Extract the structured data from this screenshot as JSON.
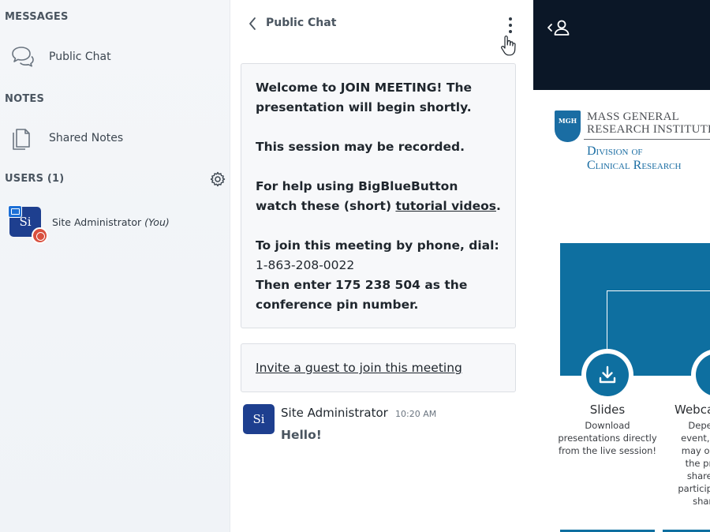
{
  "sidebar": {
    "messages_label": "MESSAGES",
    "public_chat_label": "Public Chat",
    "notes_label": "NOTES",
    "shared_notes_label": "Shared Notes",
    "users_label": "USERS (1)",
    "user": {
      "initials": "Si",
      "name": "Site Administrator",
      "you": "(You)"
    }
  },
  "chat": {
    "title": "Public Chat",
    "welcome": {
      "p1": "Welcome to JOIN MEETING! The presentation will begin shortly.",
      "p2": "This session may be recorded.",
      "p3_pre": "For help using BigBlueButton watch these (short) ",
      "p3_link": "tutorial videos",
      "p3_post": ".",
      "p4_line1": "To join this meeting by phone, dial:",
      "p4_line2": "1-863-208-0022",
      "p4_line3": "Then enter 175 238 504 as the conference pin number."
    },
    "invite_link": "Invite a guest to join this meeting",
    "message": {
      "avatar": "Si",
      "sender": "Site Administrator",
      "time": "10:20 AM",
      "text": "Hello!"
    }
  },
  "presentation": {
    "logo_seal": "MGH",
    "logo_line1": "MASS GENERAL",
    "logo_line2": "RESEARCH INSTITUTE",
    "division_line1": "Division of",
    "division_line2": "Clinical Research",
    "slides_title": "Slides",
    "slides_desc": "Download presentations directly from the live session!",
    "webcam_title": "Webca",
    "webcam_desc": "Depen\nevent, y\nmay onl\nthe pre\nshared\nparticipa\nshare"
  },
  "colors": {
    "avatar_blue": "#1e3f8f",
    "brand_blue": "#0e6fa0",
    "topbar_dark": "#0b1727",
    "moderator_badge": "#d9503f",
    "presenter_badge": "#1d70d6"
  }
}
